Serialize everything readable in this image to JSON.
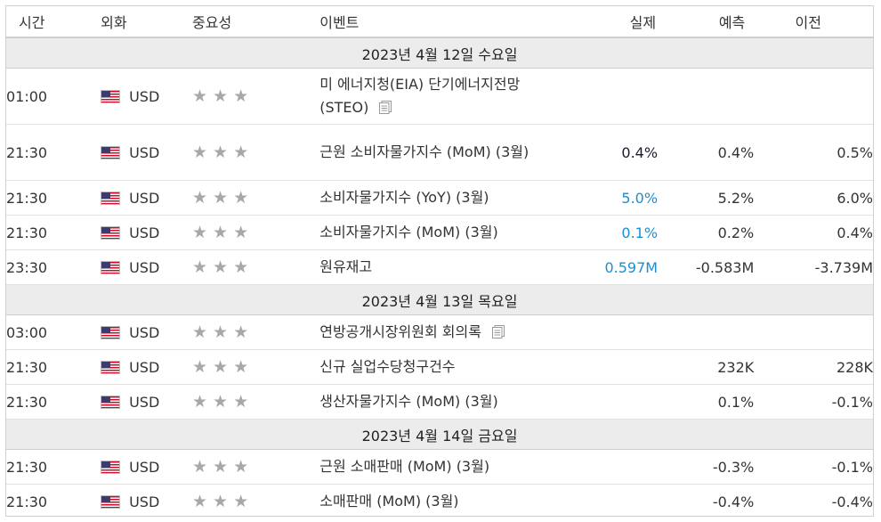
{
  "headers": {
    "time": "시간",
    "currency": "외화",
    "importance": "중요성",
    "event": "이벤트",
    "actual": "실제",
    "forecast": "예측",
    "previous": "이전"
  },
  "stars": "★★★",
  "colors": {
    "actual_blue": "#1a8fd6",
    "actual_dark": "#1a1a2e",
    "date_bg": "#ececec"
  },
  "days": [
    {
      "date": "2023년 4월 12일 수요일",
      "events": [
        {
          "time": "01:00",
          "currency": "USD",
          "event": "미 에너지청(EIA) 단기에너지전망(STEO)",
          "has_doc": true,
          "actual": "",
          "forecast": "",
          "previous": ""
        },
        {
          "time": "21:30",
          "currency": "USD",
          "event": "근원 소비자물가지수 (MoM) (3월)",
          "has_doc": false,
          "actual": "0.4%",
          "forecast": "0.4%",
          "previous": "0.5%"
        },
        {
          "time": "21:30",
          "currency": "USD",
          "event": "소비자물가지수 (YoY) (3월)",
          "has_doc": false,
          "actual": "5.0%",
          "forecast": "5.2%",
          "previous": "6.0%"
        },
        {
          "time": "21:30",
          "currency": "USD",
          "event": "소비자물가지수 (MoM) (3월)",
          "has_doc": false,
          "actual": "0.1%",
          "forecast": "0.2%",
          "previous": "0.4%"
        },
        {
          "time": "23:30",
          "currency": "USD",
          "event": "원유재고",
          "has_doc": false,
          "actual": "0.597M",
          "forecast": "-0.583M",
          "previous": "-3.739M"
        }
      ]
    },
    {
      "date": "2023년 4월 13일 목요일",
      "events": [
        {
          "time": "03:00",
          "currency": "USD",
          "event": "연방공개시장위원회 회의록",
          "has_doc": true,
          "actual": "",
          "forecast": "",
          "previous": ""
        },
        {
          "time": "21:30",
          "currency": "USD",
          "event": "신규 실업수당청구건수",
          "has_doc": false,
          "actual": "",
          "forecast": "232K",
          "previous": "228K"
        },
        {
          "time": "21:30",
          "currency": "USD",
          "event": "생산자물가지수 (MoM) (3월)",
          "has_doc": false,
          "actual": "",
          "forecast": "0.1%",
          "previous": "-0.1%"
        }
      ]
    },
    {
      "date": "2023년 4월 14일 금요일",
      "events": [
        {
          "time": "21:30",
          "currency": "USD",
          "event": "근원 소매판매 (MoM) (3월)",
          "has_doc": false,
          "actual": "",
          "forecast": "-0.3%",
          "previous": "-0.1%"
        },
        {
          "time": "21:30",
          "currency": "USD",
          "event": "소매판매 (MoM) (3월)",
          "has_doc": false,
          "actual": "",
          "forecast": "-0.4%",
          "previous": "-0.4%"
        }
      ]
    }
  ]
}
